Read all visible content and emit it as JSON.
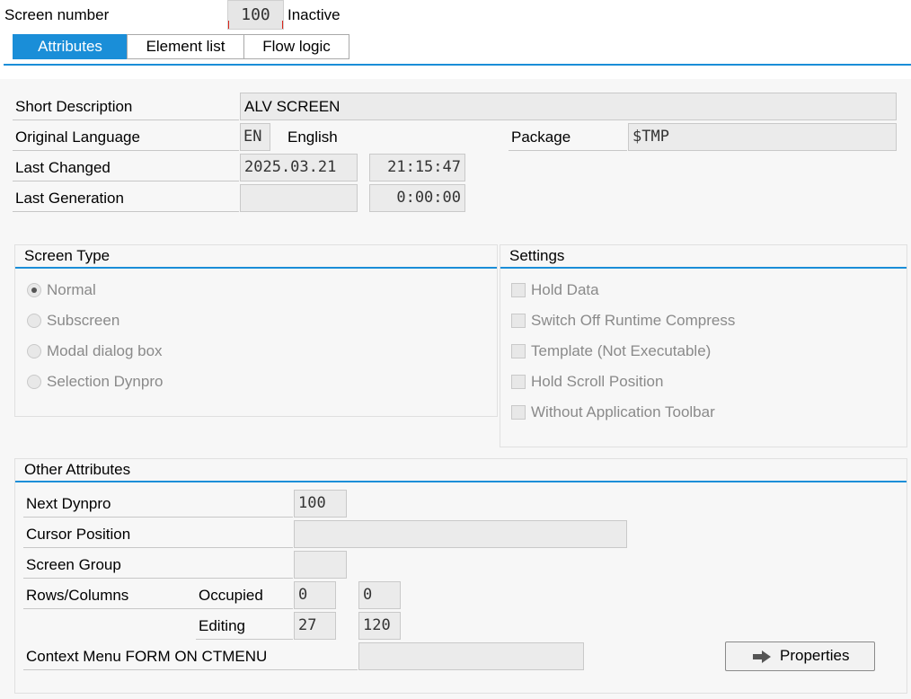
{
  "header": {
    "screen_number_label": "Screen number",
    "screen_number": "100",
    "status": "Inactive"
  },
  "tabs": [
    {
      "label": "Attributes",
      "active": true
    },
    {
      "label": "Element list",
      "active": false
    },
    {
      "label": "Flow logic",
      "active": false
    }
  ],
  "attributes": {
    "short_description_label": "Short Description",
    "short_description": "ALV SCREEN",
    "original_language_label": "Original Language",
    "language_code": "EN",
    "language_name": "English",
    "package_label": "Package",
    "package": "$TMP",
    "last_changed_label": "Last Changed",
    "last_changed_date": "2025.03.21",
    "last_changed_time": "21:15:47",
    "last_generation_label": "Last Generation",
    "last_generation_date": "",
    "last_generation_time": "0:00:00"
  },
  "screen_type": {
    "title": "Screen Type",
    "options": [
      {
        "label": "Normal",
        "selected": true
      },
      {
        "label": "Subscreen",
        "selected": false
      },
      {
        "label": "Modal dialog box",
        "selected": false
      },
      {
        "label": "Selection Dynpro",
        "selected": false
      }
    ]
  },
  "settings": {
    "title": "Settings",
    "options": [
      {
        "label": "Hold Data",
        "checked": false
      },
      {
        "label": "Switch Off Runtime Compress",
        "checked": false
      },
      {
        "label": "Template (Not Executable)",
        "checked": false
      },
      {
        "label": "Hold Scroll Position",
        "checked": false
      },
      {
        "label": "Without Application Toolbar",
        "checked": false
      }
    ]
  },
  "other": {
    "title": "Other Attributes",
    "next_dynpro_label": "Next Dynpro",
    "next_dynpro": "100",
    "cursor_position_label": "Cursor Position",
    "cursor_position": "",
    "screen_group_label": "Screen Group",
    "screen_group": "",
    "rows_columns_label": "Rows/Columns",
    "occupied_label": "Occupied",
    "occupied_rows": "0",
    "occupied_cols": "0",
    "editing_label": "Editing",
    "editing_rows": "27",
    "editing_cols": "120",
    "context_menu_label": "Context Menu FORM ON CTMENU",
    "context_menu": "",
    "properties_button": "Properties"
  },
  "colors": {
    "accent": "#1a8ed8",
    "field_bg": "#ebebeb",
    "focus_marker": "#d9261c"
  },
  "icons": {
    "properties": "arrow-right-icon"
  }
}
